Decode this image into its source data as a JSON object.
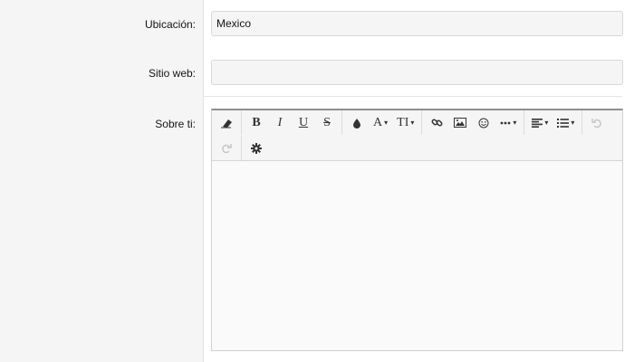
{
  "form": {
    "location": {
      "label": "Ubicación:",
      "value": "Mexico"
    },
    "website": {
      "label": "Sitio web:",
      "value": "",
      "placeholder": ""
    },
    "about": {
      "label": "Sobre ti:",
      "value": ""
    }
  },
  "editor": {
    "toolbar": {
      "bold_glyph": "B",
      "italic_glyph": "I",
      "underline_glyph": "U",
      "strike_glyph": "S",
      "font_glyph": "A",
      "size_glyph": "TI",
      "caret": "▾"
    }
  }
}
